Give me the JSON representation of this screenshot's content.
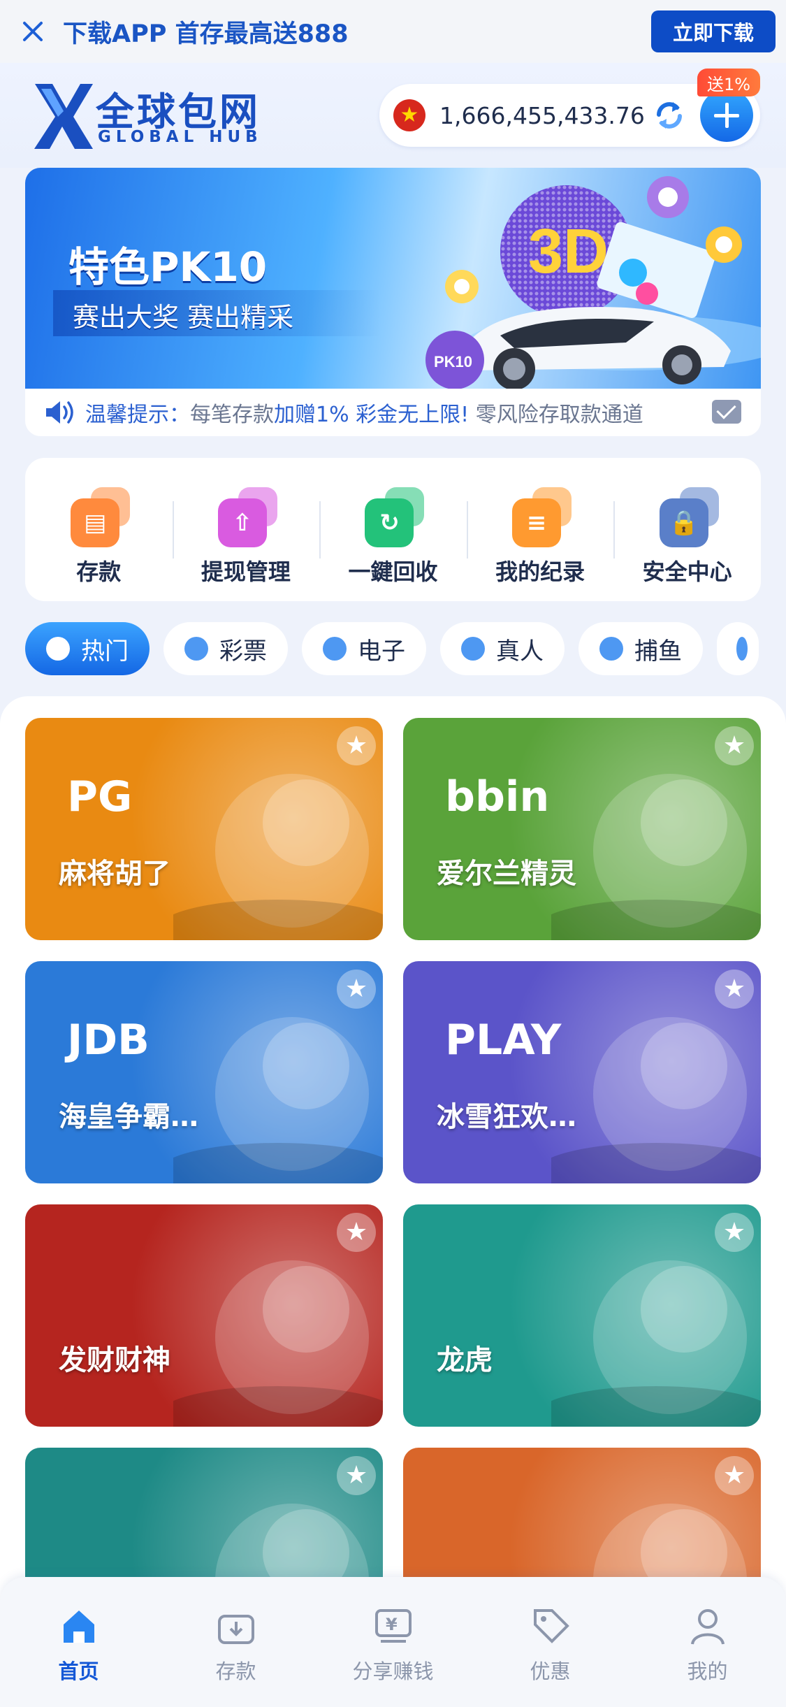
{
  "topbar": {
    "promo_text": "下载APP 首存最高送888",
    "download_button": "立即下载"
  },
  "header": {
    "logo_cn": "全球包网",
    "logo_en": "GLOBAL HUB",
    "balance": "1,666,455,433.76",
    "bonus_tag": "送1%"
  },
  "banner": {
    "title": "特色PK10",
    "subtitle": "赛出大奖 赛出精采",
    "slide_count": 14,
    "active_slide": 13
  },
  "notice": {
    "label": "温馨提示：",
    "text_before": "每笔存款",
    "text_highlight": "加赠1% 彩金无上限!",
    "text_after": " 零风险存取款通道"
  },
  "quick_actions": [
    {
      "label": "存款",
      "icon": "wallet-icon",
      "color": "#ff8a3d"
    },
    {
      "label": "提现管理",
      "icon": "withdraw-icon",
      "color": "#d95be0"
    },
    {
      "label": "一鍵回收",
      "icon": "recycle-icon",
      "color": "#23c27a"
    },
    {
      "label": "我的纪录",
      "icon": "records-icon",
      "color": "#ff9a30"
    },
    {
      "label": "安全中心",
      "icon": "shield-icon",
      "color": "#5a7fc9"
    }
  ],
  "tabs": [
    {
      "label": "热门",
      "icon": "fire-icon",
      "active": true
    },
    {
      "label": "彩票",
      "icon": "lottery-icon",
      "active": false
    },
    {
      "label": "电子",
      "icon": "slot-icon",
      "active": false
    },
    {
      "label": "真人",
      "icon": "live-icon",
      "active": false
    },
    {
      "label": "捕鱼",
      "icon": "fish-icon",
      "active": false
    },
    {
      "label": "",
      "icon": "sports-icon",
      "active": false
    }
  ],
  "games": [
    {
      "brand": "PG",
      "name": "麻将胡了",
      "bg": "#e98a12"
    },
    {
      "brand": "bbin",
      "name": "爱尔兰精灵",
      "bg": "#5aa33a"
    },
    {
      "brand": "JDB",
      "name": "海皇争霸…",
      "bg": "#2b7ad8"
    },
    {
      "brand": "PLAY",
      "name": "冰雪狂欢…",
      "bg": "#5b54c9"
    },
    {
      "brand": "",
      "name": "发财财神",
      "bg": "#b5251f"
    },
    {
      "brand": "",
      "name": "龙虎",
      "bg": "#1f9a8e"
    },
    {
      "brand": "",
      "name": "",
      "bg": "#1e8a86"
    },
    {
      "brand": "",
      "name": "",
      "bg": "#d9662a"
    }
  ],
  "bottom_nav": [
    {
      "label": "首页",
      "icon": "home-icon",
      "active": true
    },
    {
      "label": "存款",
      "icon": "deposit-icon",
      "active": false
    },
    {
      "label": "分享赚钱",
      "icon": "share-earn-icon",
      "active": false
    },
    {
      "label": "优惠",
      "icon": "promo-tag-icon",
      "active": false
    },
    {
      "label": "我的",
      "icon": "profile-icon",
      "active": false
    }
  ]
}
